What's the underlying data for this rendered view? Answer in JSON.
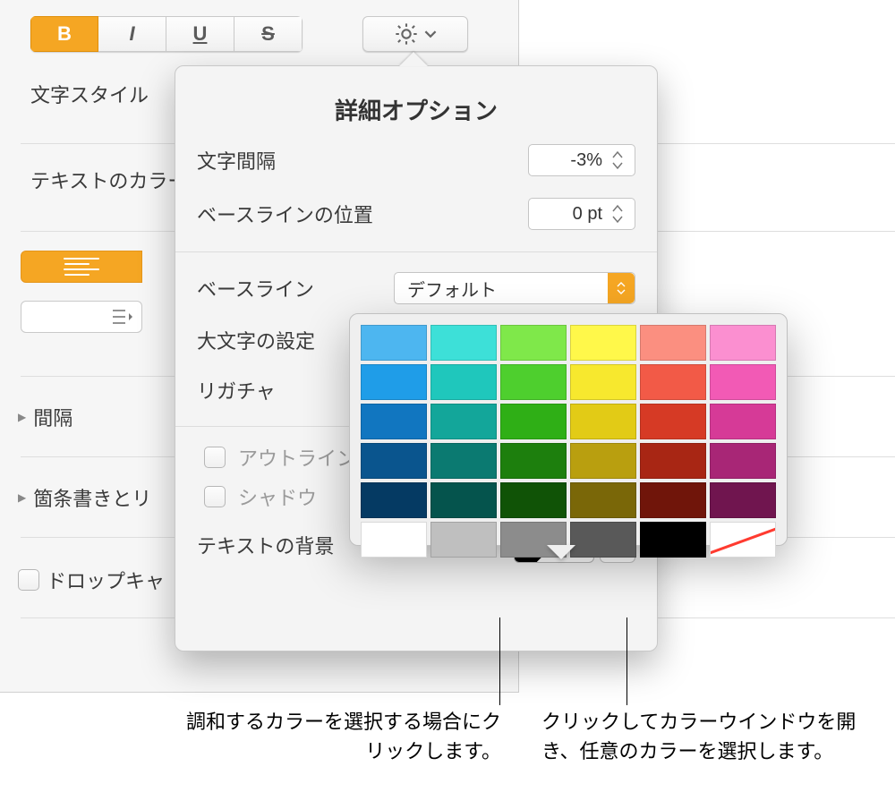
{
  "toolbar": {
    "bold": "B",
    "italic": "I",
    "underline": "U",
    "strike": "S"
  },
  "sidebar": {
    "char_style": "文字スタイル",
    "text_color": "テキストのカラー",
    "spacing": "間隔",
    "bullets": "箇条書きとリ",
    "dropcap": "ドロップキャ"
  },
  "popover": {
    "title": "詳細オプション",
    "char_spacing_label": "文字間隔",
    "char_spacing_value": "-3%",
    "baseline_pos_label": "ベースラインの位置",
    "baseline_pos_value": "0 pt",
    "baseline_label": "ベースライン",
    "baseline_value": "デフォルト",
    "caps_label": "大文字の設定",
    "ligature_label": "リガチャ",
    "outline_label": "アウトライン",
    "shadow_label": "シャドウ",
    "text_bg_label": "テキストの背景"
  },
  "palette_colors": [
    [
      "#4db6f0",
      "#3de0d8",
      "#7fe84a",
      "#fff84a",
      "#fb8f80",
      "#fb8fd0"
    ],
    [
      "#1f9de8",
      "#1fc7bc",
      "#4ecf2e",
      "#f7e82e",
      "#f25a47",
      "#f25ab5"
    ],
    [
      "#1176c0",
      "#13a69a",
      "#2faf16",
      "#e2cb16",
      "#d63a25",
      "#d63a97"
    ],
    [
      "#0a558e",
      "#0b7a71",
      "#1d7f0d",
      "#b99f0f",
      "#a82614",
      "#a82676"
    ],
    [
      "#053a63",
      "#05544d",
      "#105306",
      "#7a6708",
      "#70150a",
      "#70154f"
    ]
  ],
  "specials": [
    "#ffffff",
    "#bfbfbf",
    "#8c8c8c",
    "#595959",
    "#000000",
    "none"
  ],
  "callouts": {
    "left": "調和するカラーを選択する場合にクリックします。",
    "right": "クリックしてカラーウインドウを開き、任意のカラーを選択します。"
  }
}
